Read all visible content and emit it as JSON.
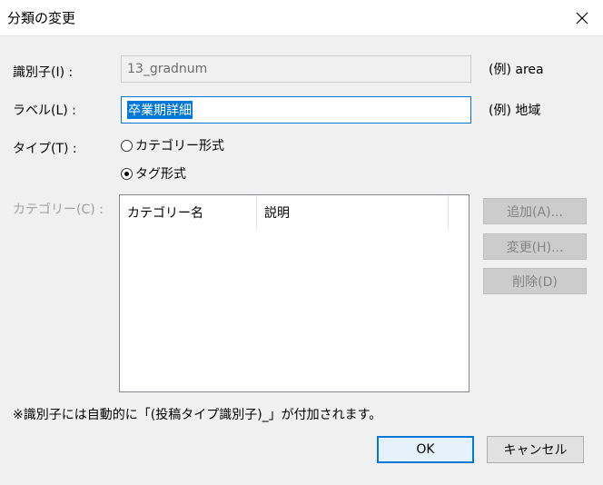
{
  "window": {
    "title": "分類の変更",
    "close_icon": "close-icon"
  },
  "form": {
    "identifier_label": "識別子(I) :",
    "identifier_value": "13_gradnum",
    "identifier_example": "(例) area",
    "label_label": "ラベル(L) :",
    "label_value": "卒業期詳細",
    "label_example": "(例) 地域",
    "type_label": "タイプ(T) :",
    "type_options": [
      {
        "label": "カテゴリー形式",
        "checked": false
      },
      {
        "label": "タグ形式",
        "checked": true
      }
    ],
    "category_label": "カテゴリー(C) :"
  },
  "category_list": {
    "columns": [
      "カテゴリー名",
      "説明"
    ]
  },
  "side_buttons": {
    "add": "追加(A)...",
    "change": "変更(H)...",
    "delete": "削除(D)"
  },
  "footer": {
    "note": "※識別子には自動的に「(投稿タイプ識別子)_」が付加されます。",
    "ok": "OK",
    "cancel": "キャンセル"
  },
  "colors": {
    "accent": "#0078d7",
    "background": "#f0f0f0"
  }
}
